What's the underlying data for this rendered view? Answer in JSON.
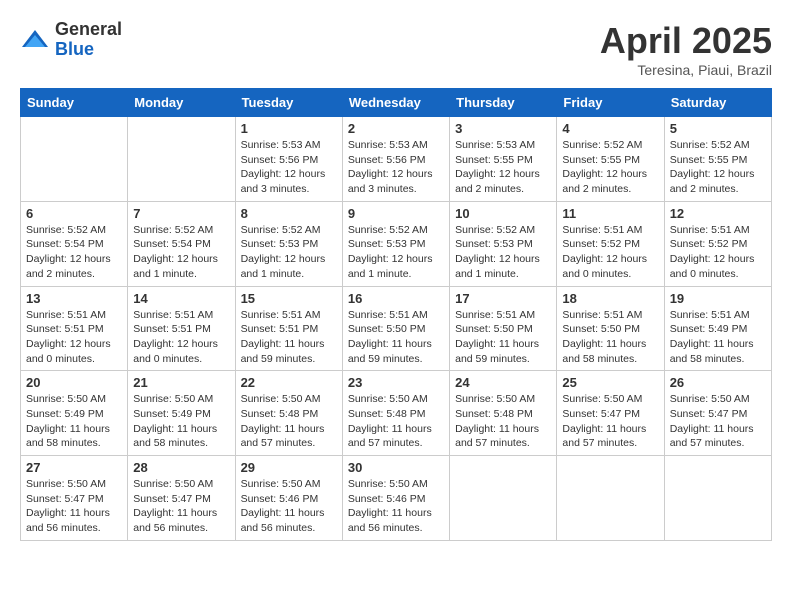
{
  "header": {
    "logo_general": "General",
    "logo_blue": "Blue",
    "month_title": "April 2025",
    "location": "Teresina, Piaui, Brazil"
  },
  "weekdays": [
    "Sunday",
    "Monday",
    "Tuesday",
    "Wednesday",
    "Thursday",
    "Friday",
    "Saturday"
  ],
  "weeks": [
    [
      {
        "day": "",
        "info": ""
      },
      {
        "day": "",
        "info": ""
      },
      {
        "day": "1",
        "info": "Sunrise: 5:53 AM\nSunset: 5:56 PM\nDaylight: 12 hours and 3 minutes."
      },
      {
        "day": "2",
        "info": "Sunrise: 5:53 AM\nSunset: 5:56 PM\nDaylight: 12 hours and 3 minutes."
      },
      {
        "day": "3",
        "info": "Sunrise: 5:53 AM\nSunset: 5:55 PM\nDaylight: 12 hours and 2 minutes."
      },
      {
        "day": "4",
        "info": "Sunrise: 5:52 AM\nSunset: 5:55 PM\nDaylight: 12 hours and 2 minutes."
      },
      {
        "day": "5",
        "info": "Sunrise: 5:52 AM\nSunset: 5:55 PM\nDaylight: 12 hours and 2 minutes."
      }
    ],
    [
      {
        "day": "6",
        "info": "Sunrise: 5:52 AM\nSunset: 5:54 PM\nDaylight: 12 hours and 2 minutes."
      },
      {
        "day": "7",
        "info": "Sunrise: 5:52 AM\nSunset: 5:54 PM\nDaylight: 12 hours and 1 minute."
      },
      {
        "day": "8",
        "info": "Sunrise: 5:52 AM\nSunset: 5:53 PM\nDaylight: 12 hours and 1 minute."
      },
      {
        "day": "9",
        "info": "Sunrise: 5:52 AM\nSunset: 5:53 PM\nDaylight: 12 hours and 1 minute."
      },
      {
        "day": "10",
        "info": "Sunrise: 5:52 AM\nSunset: 5:53 PM\nDaylight: 12 hours and 1 minute."
      },
      {
        "day": "11",
        "info": "Sunrise: 5:51 AM\nSunset: 5:52 PM\nDaylight: 12 hours and 0 minutes."
      },
      {
        "day": "12",
        "info": "Sunrise: 5:51 AM\nSunset: 5:52 PM\nDaylight: 12 hours and 0 minutes."
      }
    ],
    [
      {
        "day": "13",
        "info": "Sunrise: 5:51 AM\nSunset: 5:51 PM\nDaylight: 12 hours and 0 minutes."
      },
      {
        "day": "14",
        "info": "Sunrise: 5:51 AM\nSunset: 5:51 PM\nDaylight: 12 hours and 0 minutes."
      },
      {
        "day": "15",
        "info": "Sunrise: 5:51 AM\nSunset: 5:51 PM\nDaylight: 11 hours and 59 minutes."
      },
      {
        "day": "16",
        "info": "Sunrise: 5:51 AM\nSunset: 5:50 PM\nDaylight: 11 hours and 59 minutes."
      },
      {
        "day": "17",
        "info": "Sunrise: 5:51 AM\nSunset: 5:50 PM\nDaylight: 11 hours and 59 minutes."
      },
      {
        "day": "18",
        "info": "Sunrise: 5:51 AM\nSunset: 5:50 PM\nDaylight: 11 hours and 58 minutes."
      },
      {
        "day": "19",
        "info": "Sunrise: 5:51 AM\nSunset: 5:49 PM\nDaylight: 11 hours and 58 minutes."
      }
    ],
    [
      {
        "day": "20",
        "info": "Sunrise: 5:50 AM\nSunset: 5:49 PM\nDaylight: 11 hours and 58 minutes."
      },
      {
        "day": "21",
        "info": "Sunrise: 5:50 AM\nSunset: 5:49 PM\nDaylight: 11 hours and 58 minutes."
      },
      {
        "day": "22",
        "info": "Sunrise: 5:50 AM\nSunset: 5:48 PM\nDaylight: 11 hours and 57 minutes."
      },
      {
        "day": "23",
        "info": "Sunrise: 5:50 AM\nSunset: 5:48 PM\nDaylight: 11 hours and 57 minutes."
      },
      {
        "day": "24",
        "info": "Sunrise: 5:50 AM\nSunset: 5:48 PM\nDaylight: 11 hours and 57 minutes."
      },
      {
        "day": "25",
        "info": "Sunrise: 5:50 AM\nSunset: 5:47 PM\nDaylight: 11 hours and 57 minutes."
      },
      {
        "day": "26",
        "info": "Sunrise: 5:50 AM\nSunset: 5:47 PM\nDaylight: 11 hours and 57 minutes."
      }
    ],
    [
      {
        "day": "27",
        "info": "Sunrise: 5:50 AM\nSunset: 5:47 PM\nDaylight: 11 hours and 56 minutes."
      },
      {
        "day": "28",
        "info": "Sunrise: 5:50 AM\nSunset: 5:47 PM\nDaylight: 11 hours and 56 minutes."
      },
      {
        "day": "29",
        "info": "Sunrise: 5:50 AM\nSunset: 5:46 PM\nDaylight: 11 hours and 56 minutes."
      },
      {
        "day": "30",
        "info": "Sunrise: 5:50 AM\nSunset: 5:46 PM\nDaylight: 11 hours and 56 minutes."
      },
      {
        "day": "",
        "info": ""
      },
      {
        "day": "",
        "info": ""
      },
      {
        "day": "",
        "info": ""
      }
    ]
  ]
}
